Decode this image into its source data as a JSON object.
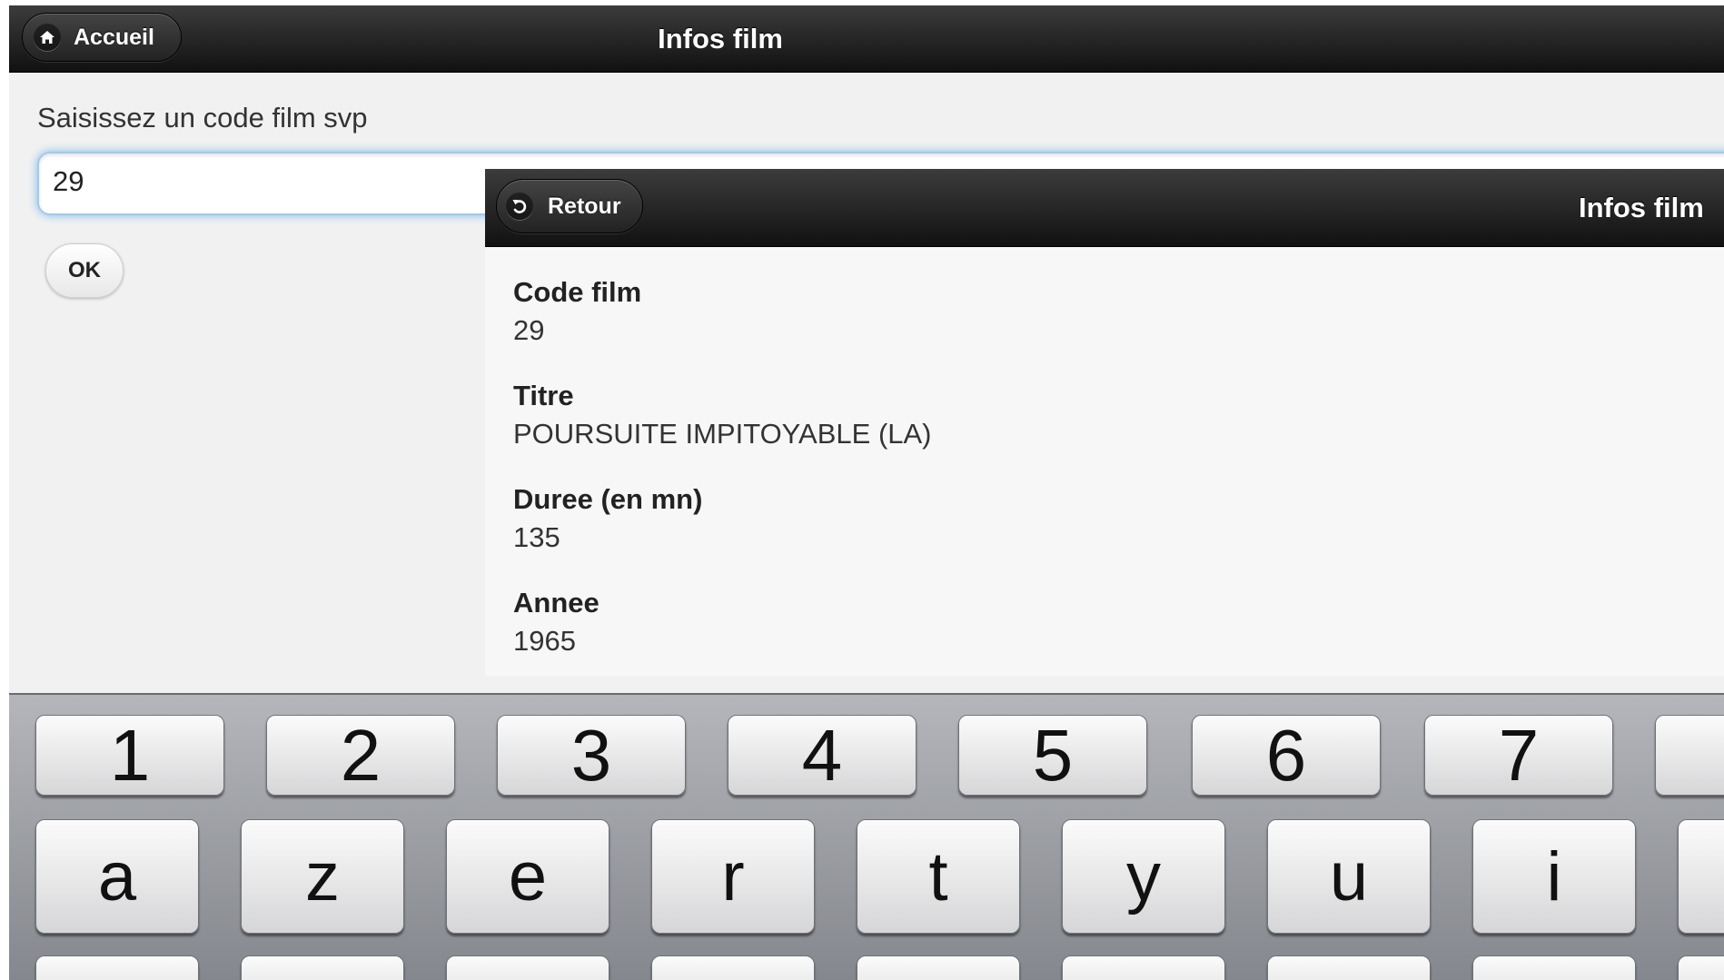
{
  "main_header": {
    "title": "Infos film",
    "home_button": {
      "label": "Accueil",
      "icon": "home-icon"
    }
  },
  "form": {
    "prompt": "Saisissez un code film svp",
    "code_value": "29",
    "ok_label": "OK"
  },
  "detail": {
    "header_title": "Infos film",
    "back_button": {
      "label": "Retour",
      "icon": "back-arrow-icon"
    },
    "fields": [
      {
        "label": "Code film",
        "value": "29"
      },
      {
        "label": "Titre",
        "value": "POURSUITE IMPITOYABLE (LA)"
      },
      {
        "label": "Duree (en mn)",
        "value": "135"
      },
      {
        "label": "Annee",
        "value": "1965"
      }
    ]
  },
  "keyboard": {
    "number_row": [
      "1",
      "2",
      "3",
      "4",
      "5",
      "6",
      "7",
      ""
    ],
    "letter_row": [
      "a",
      "z",
      "e",
      "r",
      "t",
      "y",
      "u",
      "i",
      ""
    ]
  },
  "colors": {
    "header_bg": "#1a1a1a",
    "page_bg": "#f1f1f1",
    "input_focus_glow": "#7cb8ee"
  }
}
